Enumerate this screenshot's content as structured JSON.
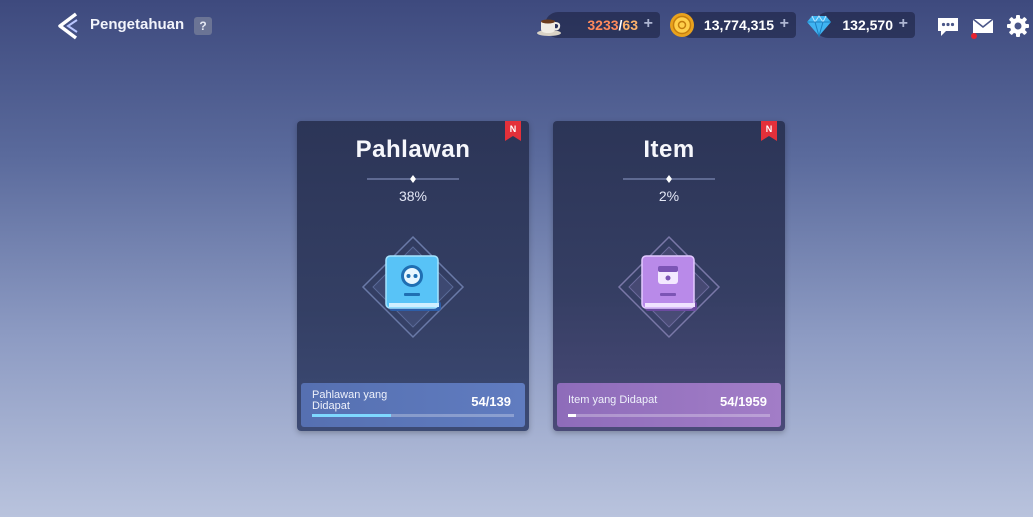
{
  "header": {
    "title": "Pengetahuan",
    "help_label": "?"
  },
  "resources": {
    "stamina_current": "3233",
    "stamina_separator": "/",
    "stamina_max": "63",
    "gold": "13,774,315",
    "gems": "132,570",
    "plus_label": "+"
  },
  "cards": [
    {
      "title": "Pahlawan",
      "percent": "38%",
      "collected_label_line1": "Pahlawan yang",
      "collected_label_line2": "Didapat",
      "count": "54/139",
      "progress_fraction": 0.39,
      "badge": "N",
      "accent_color": "#5bb9f0"
    },
    {
      "title": "Item",
      "percent": "2%",
      "collected_label": "Item yang Didapat",
      "count": "54/1959",
      "progress_fraction": 0.03,
      "badge": "N",
      "accent_color": "#b78ee6"
    }
  ],
  "icons": {
    "back": "back-arrow-icon",
    "stamina": "coffee-cup-icon",
    "gold": "gold-coin-icon",
    "gem": "diamond-icon",
    "chat": "chat-bubble-icon",
    "mail": "mail-icon",
    "settings": "gear-icon"
  }
}
